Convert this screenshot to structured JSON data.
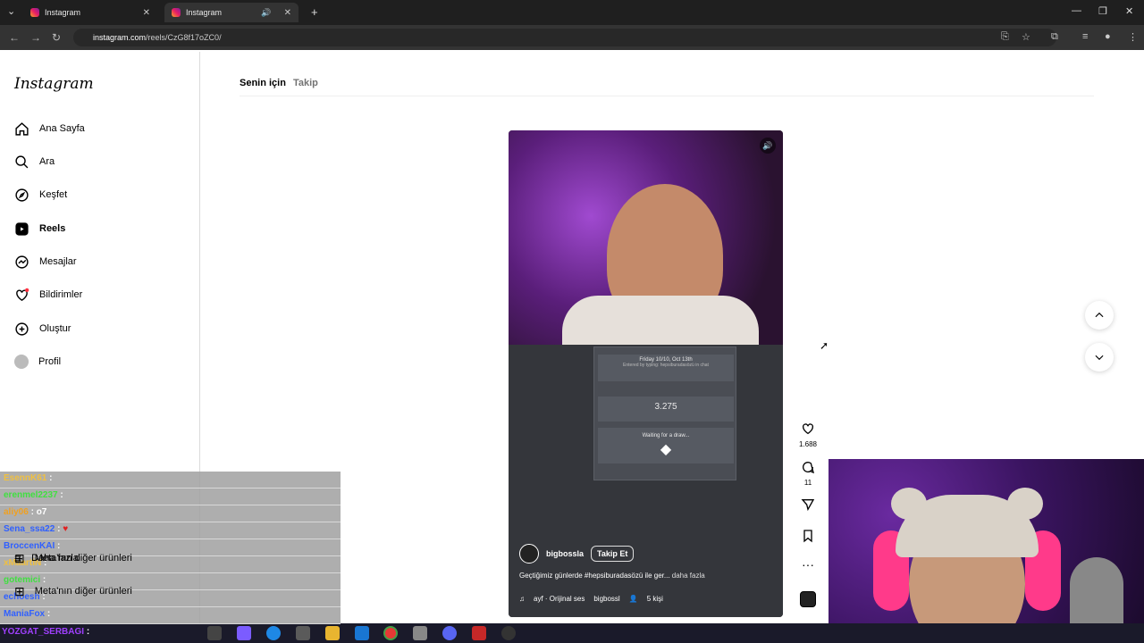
{
  "browser": {
    "tabs": [
      {
        "title": "Instagram",
        "active": false
      },
      {
        "title": "Instagram",
        "active": true
      }
    ],
    "url_host": "instagram.com",
    "url_path": "/reels/CzG8f17oZC0/"
  },
  "sidebar": {
    "logo": "Instagram",
    "items": [
      {
        "label": "Ana Sayfa",
        "icon": "home-icon"
      },
      {
        "label": "Ara",
        "icon": "search-icon"
      },
      {
        "label": "Keşfet",
        "icon": "compass-icon"
      },
      {
        "label": "Reels",
        "icon": "reels-icon",
        "active": true
      },
      {
        "label": "Mesajlar",
        "icon": "messenger-icon"
      },
      {
        "label": "Bildirimler",
        "icon": "heart-icon"
      },
      {
        "label": "Oluştur",
        "icon": "plus-square-icon"
      },
      {
        "label": "Profil",
        "icon": "avatar"
      }
    ],
    "more": {
      "label": "Daha fazla",
      "icon": "menu-icon"
    },
    "meta": {
      "label": "Meta'nın diğer ürünleri",
      "icon": "grid-icon"
    }
  },
  "feed": {
    "tab_for_you": "Senin için",
    "tab_following": "Takip"
  },
  "reel": {
    "username": "bigbossla",
    "follow_label": "Takip Et",
    "caption": "Geçtiğimiz günlerde #hepsiburadasözü ile ger...",
    "caption_more": "daha fazla",
    "audio": "ayf · Orijinal ses",
    "audio_user": "bigbossl",
    "audio_people": "5 kişi",
    "likes": "1.688",
    "comments": "11",
    "dialog": {
      "date": "Friday 10/10, Oct 13th",
      "joined": "Entered by typing: hepsiburadasözü in chat",
      "value": "3.275",
      "waiting": "Waiting for a draw..."
    }
  },
  "chat": [
    {
      "user": "EsennK61",
      "msg": ":",
      "color": "#f0c040"
    },
    {
      "user": "erenmel2237",
      "msg": ":",
      "color": "#40e040"
    },
    {
      "user": "aliy06",
      "msg": ": o7",
      "color": "#f0a020"
    },
    {
      "user": "Sena_ssa22",
      "msg": ":",
      "color": "#3060ff"
    },
    {
      "user": "BroccenKAI",
      "msg": ":",
      "color": "#3060ff"
    },
    {
      "user": "xMaartiN",
      "msg": ":",
      "color": "#f0c040"
    },
    {
      "user": "gotemici",
      "msg": ":",
      "color": "#40e040"
    },
    {
      "user": "echoesh",
      "msg": ":",
      "color": "#3060ff"
    },
    {
      "user": "ManiaFox",
      "msg": ":",
      "color": "#3060ff"
    },
    {
      "user": "YOZGAT_SERBAGI",
      "msg": ":",
      "color": "#a040ff"
    }
  ]
}
